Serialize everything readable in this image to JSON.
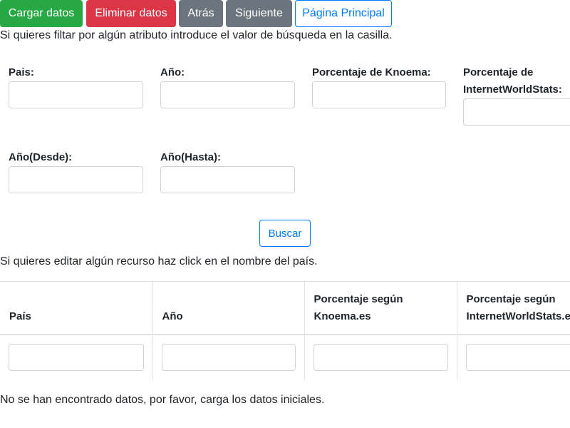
{
  "toolbar": {
    "load_label": "Cargar datos",
    "delete_label": "Eliminar datos",
    "back_label": "Atrás",
    "next_label": "Siguiente",
    "home_label": "Página Principal"
  },
  "filter": {
    "hint": "Si quieres filtar por algún atributo introduce el valor de búsqueda en la casilla.",
    "country_label": "Pais:",
    "year_label": "Año:",
    "knoema_label": "Porcentaje de Knoema:",
    "iws_label_line1": "Porcentaje de",
    "iws_label_line2": "InternetWorldStats:",
    "year_from_label": "Año(Desde):",
    "year_to_label": "Año(Hasta):",
    "country_value": "",
    "year_value": "",
    "knoema_value": "",
    "iws_value": "",
    "year_from_value": "",
    "year_to_value": "",
    "search_label": "Buscar"
  },
  "edit_hint": "Si quieres editar algún recurso haz click en el nombre del país.",
  "table": {
    "col_country": "País",
    "col_year": "Año",
    "col_knoema_line1": "Porcentaje según",
    "col_knoema_line2": "Knoema.es",
    "col_iws_line1": "Porcentaje según",
    "col_iws_line2": "InternetWorldStats.es"
  },
  "empty_message": "No se han encontrado datos, por favor, carga los datos iniciales."
}
